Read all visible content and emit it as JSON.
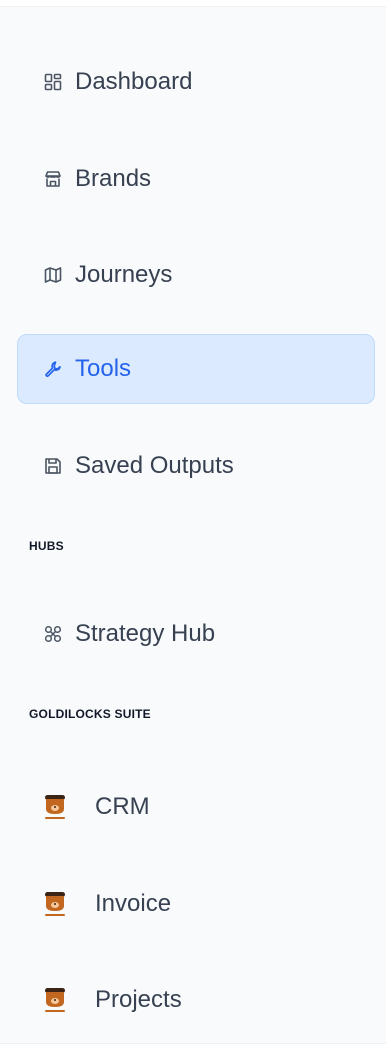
{
  "nav": {
    "items": [
      {
        "label": "Dashboard",
        "icon": "dashboard-icon"
      },
      {
        "label": "Brands",
        "icon": "store-icon"
      },
      {
        "label": "Journeys",
        "icon": "map-icon"
      },
      {
        "label": "Tools",
        "icon": "wrench-icon",
        "active": true
      },
      {
        "label": "Saved Outputs",
        "icon": "save-icon"
      }
    ]
  },
  "hubs": {
    "title": "HUBS",
    "items": [
      {
        "label": "Strategy Hub",
        "icon": "strategy-icon"
      }
    ]
  },
  "suite": {
    "title": "GOLDILOCKS SUITE",
    "items": [
      {
        "label": "CRM",
        "icon": "goldilocks-logo"
      },
      {
        "label": "Invoice",
        "icon": "goldilocks-logo"
      },
      {
        "label": "Projects",
        "icon": "goldilocks-logo"
      }
    ]
  },
  "colors": {
    "active_bg": "#dbeafe",
    "active_text": "#2563eb",
    "sidebar_bg": "#f9fafb",
    "logo_brown": "#b45309"
  }
}
